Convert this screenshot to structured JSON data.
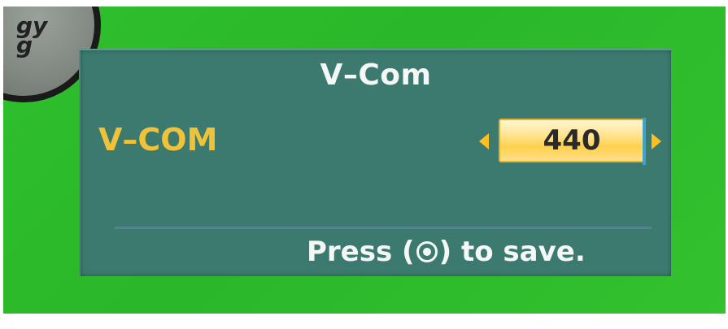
{
  "logo": {
    "text": "gy\ng",
    "icon": "circular-logo-badge"
  },
  "osd": {
    "title": "V–Com",
    "setting": {
      "label": "V–COM",
      "value": "440",
      "left_arrow_icon": "arrow-left-icon",
      "right_arrow_icon": "arrow-right-icon"
    },
    "hint": {
      "prefix": "Press (",
      "icon": "ok-button-icon",
      "suffix": ") to save."
    }
  },
  "colors": {
    "background_green": "#2fbf2c",
    "panel": "#3c7a70",
    "label_yellow": "#f0c23a",
    "arrow_yellow": "#ffbf20",
    "value_box": "#ffd04d",
    "divider": "#5a7f98"
  }
}
